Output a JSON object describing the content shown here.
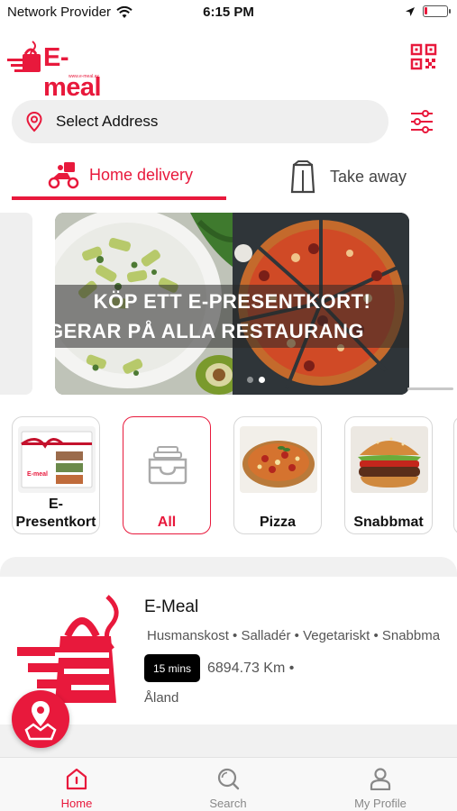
{
  "status_bar": {
    "carrier": "Network Provider",
    "time": "6:15 PM",
    "battery_level": 0.12
  },
  "header": {
    "logo_text": "E-meal",
    "logo_tagline": "www.e-meal.ax",
    "qr_icon": "qr-code-icon"
  },
  "address": {
    "placeholder": "Select Address",
    "pin_icon": "location-pin-icon",
    "filter_icon": "filter-sliders-icon"
  },
  "tabs": [
    {
      "label": "Home delivery",
      "icon": "scooter-icon",
      "active": true
    },
    {
      "label": "Take away",
      "icon": "bag-icon",
      "active": false
    }
  ],
  "banner": {
    "line1": "KÖP ETT E-PRESENTKORT!",
    "line2": "GERAR PÅ ALLA RESTAURANG",
    "active_slide": 1,
    "slide_count": 2
  },
  "categories": [
    {
      "label_line1": "E-",
      "label_line2": "Presentkort",
      "active": false
    },
    {
      "label": "All",
      "icon": "inbox-tray-icon",
      "active": true
    },
    {
      "label": "Pizza",
      "active": false
    },
    {
      "label": "Snabbmat",
      "active": false
    }
  ],
  "restaurant": {
    "name": "E-Meal",
    "tags": "Husmanskost • Salladér • Vegetariskt • Snabbmat",
    "delivery_time": "15 mins",
    "distance": "6894.73 Km •",
    "region": "Åland"
  },
  "fab": {
    "icon": "map-pin-icon"
  },
  "bottom_nav": [
    {
      "label": "Home",
      "icon": "home-icon",
      "active": true
    },
    {
      "label": "Search",
      "icon": "search-icon",
      "active": false
    },
    {
      "label": "My Profile",
      "icon": "profile-icon",
      "active": false
    }
  ],
  "colors": {
    "accent": "#e8193c",
    "text": "#111111",
    "muted": "#555555",
    "surface": "#efefef"
  }
}
